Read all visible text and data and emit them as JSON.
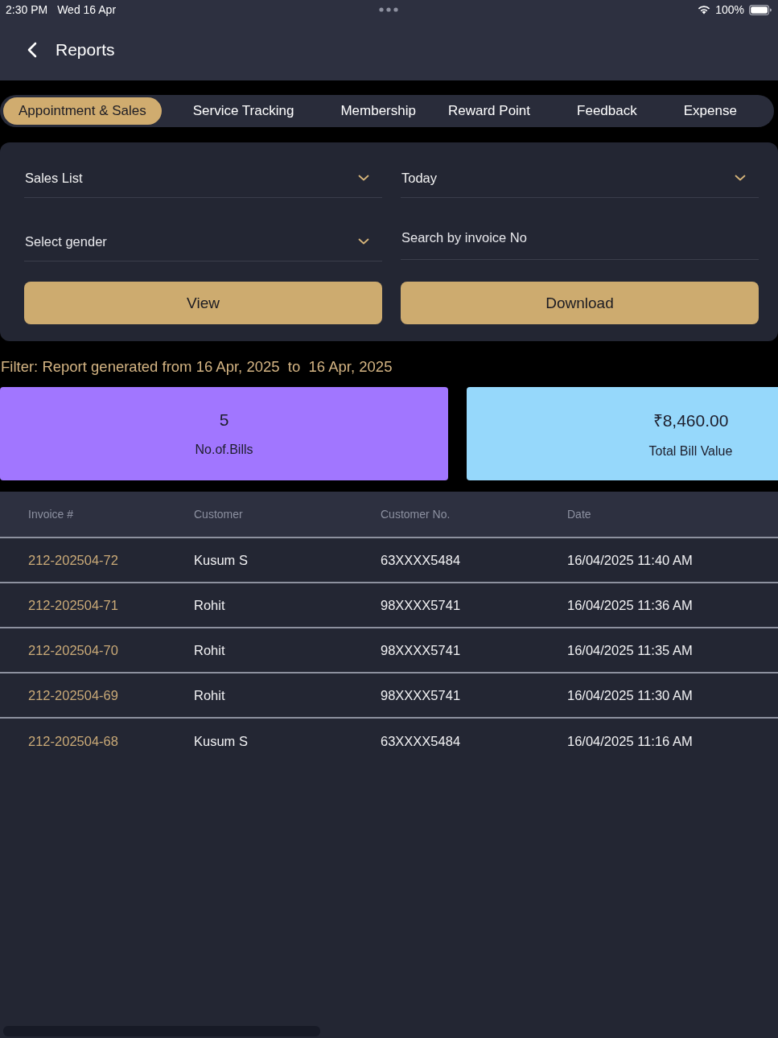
{
  "status_bar": {
    "time": "2:30 PM",
    "date": "Wed 16 Apr",
    "battery": "100%"
  },
  "header": {
    "title": "Reports"
  },
  "tabs": [
    {
      "label": "Appointment & Sales",
      "selected": true
    },
    {
      "label": "Service Tracking",
      "selected": false
    },
    {
      "label": "Membership",
      "selected": false
    },
    {
      "label": "Reward Point",
      "selected": false
    },
    {
      "label": "Feedback",
      "selected": false
    },
    {
      "label": "Expense",
      "selected": false
    }
  ],
  "fields": [
    {
      "kind": "dropdown",
      "value": "Sales List"
    },
    {
      "kind": "dropdown",
      "value": "Today"
    },
    {
      "kind": "dropdown",
      "placeholder": "Select gender"
    },
    {
      "kind": "search",
      "placeholder": "Search by invoice No"
    }
  ],
  "buttons": [
    {
      "label": "View"
    },
    {
      "label": "Download"
    }
  ],
  "filter_summary": {
    "label": "Filter:",
    "text": "Report generated from 16 Apr, 2025  to  16 Apr, 2025"
  },
  "stats": [
    {
      "value": "5",
      "label": "No.of.Bills",
      "color": "#a176ff"
    },
    {
      "value": "₹8,460.00",
      "label": "Total Bill Value",
      "color": "#96d8fb"
    }
  ],
  "table": {
    "columns": [
      "Invoice #",
      "Customer",
      "Customer No.",
      "Date"
    ],
    "rows": [
      {
        "invoice": "212-202504-72",
        "customer": "Kusum S",
        "customer_no": "63XXXX5484",
        "date": "16/04/2025 11:40 AM"
      },
      {
        "invoice": "212-202504-71",
        "customer": "Rohit",
        "customer_no": "98XXXX5741",
        "date": "16/04/2025 11:36 AM"
      },
      {
        "invoice": "212-202504-70",
        "customer": "Rohit",
        "customer_no": "98XXXX5741",
        "date": "16/04/2025 11:35 AM"
      },
      {
        "invoice": "212-202504-69",
        "customer": "Rohit",
        "customer_no": "98XXXX5741",
        "date": "16/04/2025 11:30 AM"
      },
      {
        "invoice": "212-202504-68",
        "customer": "Kusum S",
        "customer_no": "63XXXX5484",
        "date": "16/04/2025 11:16 AM"
      }
    ]
  }
}
